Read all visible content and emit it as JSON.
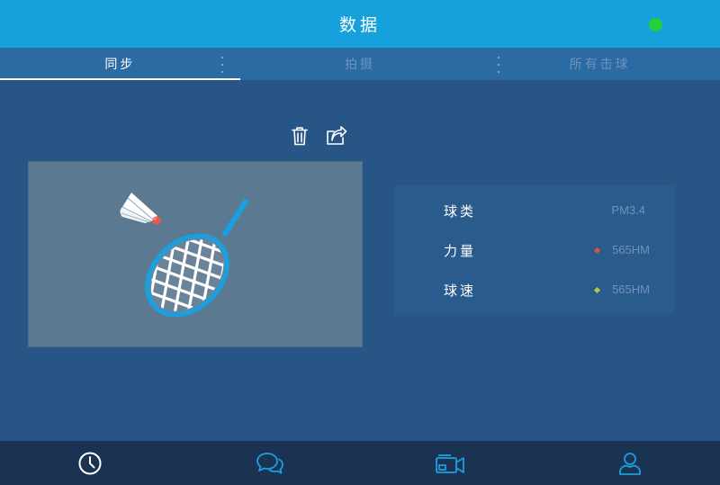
{
  "header": {
    "title": "数据",
    "status_color": "#22d13a"
  },
  "tabs": [
    {
      "label": "同步",
      "active": true
    },
    {
      "label": "拍摄",
      "active": false
    },
    {
      "label": "所有击球",
      "active": false
    }
  ],
  "toolbar": {
    "delete_icon": "trash-icon",
    "share_icon": "share-icon"
  },
  "stats": {
    "rows": [
      {
        "label": "球类",
        "value": "PM3.4",
        "marker": null
      },
      {
        "label": "力量",
        "value": "565HM",
        "marker": "#e0522e"
      },
      {
        "label": "球速",
        "value": "565HM",
        "marker": "#b6c93a"
      }
    ]
  },
  "bottom_nav": [
    {
      "icon": "clock-icon",
      "active": true
    },
    {
      "icon": "chat-icon",
      "active": false
    },
    {
      "icon": "video-camera-icon",
      "active": false
    },
    {
      "icon": "user-icon",
      "active": false
    }
  ],
  "colors": {
    "header": "#16a0dc",
    "background": "#275585",
    "accent": "#1aa0e0"
  }
}
